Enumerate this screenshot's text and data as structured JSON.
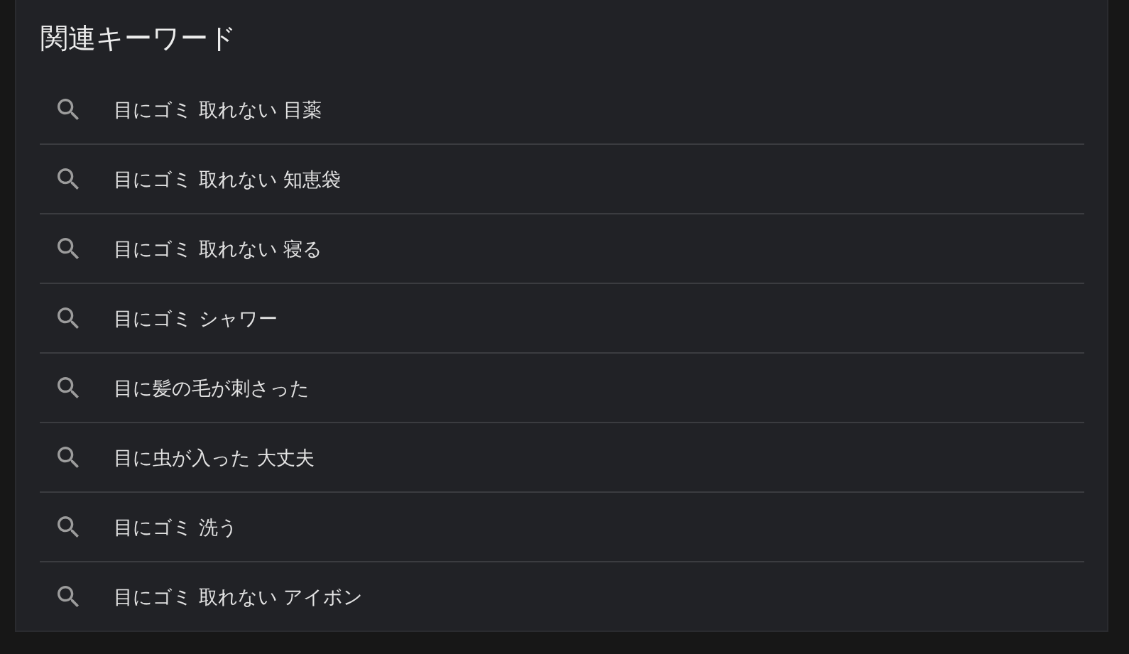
{
  "section": {
    "title": "関連キーワード"
  },
  "keywords": [
    {
      "text": "目にゴミ 取れない 目薬"
    },
    {
      "text": "目にゴミ 取れない 知恵袋"
    },
    {
      "text": "目にゴミ 取れない 寝る"
    },
    {
      "text": "目にゴミ シャワー"
    },
    {
      "text": "目に髪の毛が刺さった"
    },
    {
      "text": "目に虫が入った 大丈夫"
    },
    {
      "text": "目にゴミ 洗う"
    },
    {
      "text": "目にゴミ 取れない アイボン"
    }
  ]
}
